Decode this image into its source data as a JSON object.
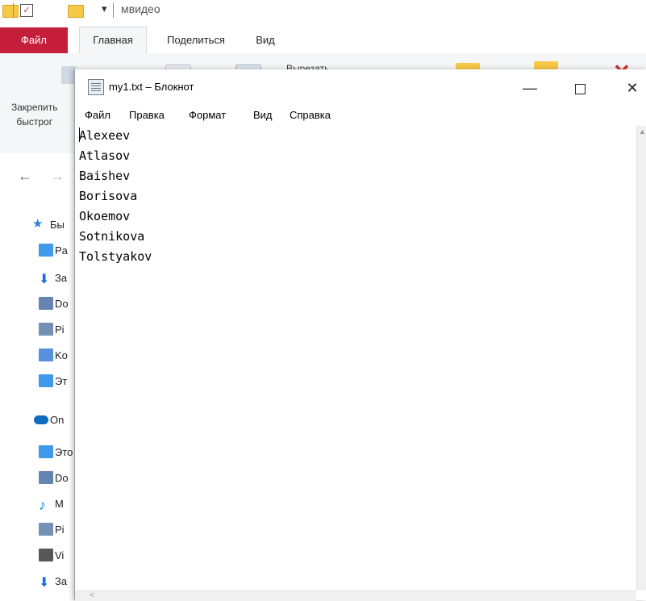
{
  "explorer": {
    "qat_title": "мвидео",
    "qat_dropdown": "▾",
    "ribbon_tabs": [
      "Файл",
      "Главная",
      "Поделиться",
      "Вид"
    ],
    "pin_label_line1": "Закрепить",
    "pin_label_line2": "быстрог",
    "cut_label": "Вырезать",
    "nav_back": "←",
    "nav_forward": "→",
    "sidebar": [
      {
        "label": "Бы",
        "icon": "star-icon",
        "color": "#2f7bd8"
      },
      {
        "label": "Pa",
        "icon": "desktop-icon",
        "color": "#1e88e5"
      },
      {
        "label": "За",
        "icon": "download-icon",
        "color": "#1e6fd9"
      },
      {
        "label": "Do",
        "icon": "document-icon",
        "color": "#4a6fa5"
      },
      {
        "label": "Pi",
        "icon": "pictures-icon",
        "color": "#5a7ca8"
      },
      {
        "label": "Ko",
        "icon": "recycle-icon",
        "color": "#3b7dd8"
      },
      {
        "label": "Эт",
        "icon": "computer-icon",
        "color": "#1e88e5"
      },
      {
        "label": "On",
        "icon": "onedrive-icon",
        "color": "#0f6cbd"
      },
      {
        "label": "Это",
        "icon": "computer-icon",
        "color": "#1e88e5"
      },
      {
        "label": "Do",
        "icon": "document-icon",
        "color": "#4a6fa5"
      },
      {
        "label": "M",
        "icon": "music-icon",
        "color": "#1e88e5"
      },
      {
        "label": "Pi",
        "icon": "pictures-icon",
        "color": "#5a7ca8"
      },
      {
        "label": "Vi",
        "icon": "video-icon",
        "color": "#3a3a3a"
      },
      {
        "label": "За",
        "icon": "download-icon",
        "color": "#1e6fd9"
      }
    ]
  },
  "notepad": {
    "title": "my1.txt – Блокнот",
    "controls": {
      "minimize": "—",
      "close": "✕"
    },
    "menu": [
      "Файл",
      "Правка",
      "Формат",
      "Вид",
      "Справка"
    ],
    "lines": [
      "Alexeev",
      "Atlasov",
      "Baishev",
      "Borisova",
      "Okoemov",
      "Sotnikova",
      "Tolstyakov"
    ],
    "scroll_up": "▲",
    "scroll_left": "<"
  },
  "colors": {
    "file_tab_bg": "#c41e3a",
    "ribbon_bg": "#f5f6f7",
    "folder_yellow": "#f7c948"
  }
}
